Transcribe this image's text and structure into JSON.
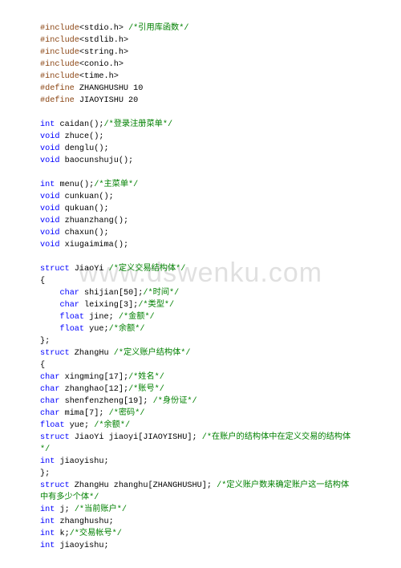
{
  "watermark": "www.dswenku.com",
  "lines": [
    [
      {
        "cls": "pre",
        "t": "#include"
      },
      {
        "cls": "id",
        "t": "<stdio.h> "
      },
      {
        "cls": "cm",
        "t": "/*引用库函数*/"
      }
    ],
    [
      {
        "cls": "pre",
        "t": "#include"
      },
      {
        "cls": "id",
        "t": "<stdlib.h>"
      }
    ],
    [
      {
        "cls": "pre",
        "t": "#include"
      },
      {
        "cls": "id",
        "t": "<string.h>"
      }
    ],
    [
      {
        "cls": "pre",
        "t": "#include"
      },
      {
        "cls": "id",
        "t": "<conio.h>"
      }
    ],
    [
      {
        "cls": "pre",
        "t": "#include"
      },
      {
        "cls": "id",
        "t": "<time.h>"
      }
    ],
    [
      {
        "cls": "pre",
        "t": "#define"
      },
      {
        "cls": "id",
        "t": " ZHANGHUSHU 10"
      }
    ],
    [
      {
        "cls": "pre",
        "t": "#define"
      },
      {
        "cls": "id",
        "t": " JIAOYISHU 20"
      }
    ],
    [],
    [
      {
        "cls": "kw",
        "t": "int"
      },
      {
        "cls": "id",
        "t": " caidan();"
      },
      {
        "cls": "cm",
        "t": "/*登录注册菜单*/"
      }
    ],
    [
      {
        "cls": "kw",
        "t": "void"
      },
      {
        "cls": "id",
        "t": " zhuce();"
      }
    ],
    [
      {
        "cls": "kw",
        "t": "void"
      },
      {
        "cls": "id",
        "t": " denglu();"
      }
    ],
    [
      {
        "cls": "kw",
        "t": "void"
      },
      {
        "cls": "id",
        "t": " baocunshuju();"
      }
    ],
    [],
    [
      {
        "cls": "kw",
        "t": "int"
      },
      {
        "cls": "id",
        "t": " menu();"
      },
      {
        "cls": "cm",
        "t": "/*主菜单*/"
      }
    ],
    [
      {
        "cls": "kw",
        "t": "void"
      },
      {
        "cls": "id",
        "t": " cunkuan();"
      }
    ],
    [
      {
        "cls": "kw",
        "t": "void"
      },
      {
        "cls": "id",
        "t": " qukuan();"
      }
    ],
    [
      {
        "cls": "kw",
        "t": "void"
      },
      {
        "cls": "id",
        "t": " zhuanzhang();"
      }
    ],
    [
      {
        "cls": "kw",
        "t": "void"
      },
      {
        "cls": "id",
        "t": " chaxun();"
      }
    ],
    [
      {
        "cls": "kw",
        "t": "void"
      },
      {
        "cls": "id",
        "t": " xiugaimima();"
      }
    ],
    [],
    [
      {
        "cls": "kw",
        "t": "struct"
      },
      {
        "cls": "id",
        "t": " JiaoYi "
      },
      {
        "cls": "cm",
        "t": "/*定义交易结构体*/"
      }
    ],
    [
      {
        "cls": "id",
        "t": "{"
      }
    ],
    [
      {
        "cls": "id",
        "t": "    "
      },
      {
        "cls": "kw",
        "t": "char"
      },
      {
        "cls": "id",
        "t": " shijian[50];"
      },
      {
        "cls": "cm",
        "t": "/*时间*/"
      }
    ],
    [
      {
        "cls": "id",
        "t": "    "
      },
      {
        "cls": "kw",
        "t": "char"
      },
      {
        "cls": "id",
        "t": " leixing[3];"
      },
      {
        "cls": "cm",
        "t": "/*类型*/"
      }
    ],
    [
      {
        "cls": "id",
        "t": "    "
      },
      {
        "cls": "kw",
        "t": "float"
      },
      {
        "cls": "id",
        "t": " jine; "
      },
      {
        "cls": "cm",
        "t": "/*金额*/"
      }
    ],
    [
      {
        "cls": "id",
        "t": "    "
      },
      {
        "cls": "kw",
        "t": "float"
      },
      {
        "cls": "id",
        "t": " yue;"
      },
      {
        "cls": "cm",
        "t": "/*余额*/"
      }
    ],
    [
      {
        "cls": "id",
        "t": "};"
      }
    ],
    [
      {
        "cls": "kw",
        "t": "struct"
      },
      {
        "cls": "id",
        "t": " ZhangHu "
      },
      {
        "cls": "cm",
        "t": "/*定义账户结构体*/"
      }
    ],
    [
      {
        "cls": "id",
        "t": "{"
      }
    ],
    [
      {
        "cls": "kw",
        "t": "char"
      },
      {
        "cls": "id",
        "t": " xingming[17];"
      },
      {
        "cls": "cm",
        "t": "/*姓名*/"
      }
    ],
    [
      {
        "cls": "kw",
        "t": "char"
      },
      {
        "cls": "id",
        "t": " zhanghao[12];"
      },
      {
        "cls": "cm",
        "t": "/*账号*/"
      }
    ],
    [
      {
        "cls": "kw",
        "t": "char"
      },
      {
        "cls": "id",
        "t": " shenfenzheng[19]; "
      },
      {
        "cls": "cm",
        "t": "/*身份证*/"
      }
    ],
    [
      {
        "cls": "kw",
        "t": "char"
      },
      {
        "cls": "id",
        "t": " mima[7]; "
      },
      {
        "cls": "cm",
        "t": "/*密码*/"
      }
    ],
    [
      {
        "cls": "kw",
        "t": "float"
      },
      {
        "cls": "id",
        "t": " yue; "
      },
      {
        "cls": "cm",
        "t": "/*余额*/"
      }
    ],
    [
      {
        "cls": "kw",
        "t": "struct"
      },
      {
        "cls": "id",
        "t": " JiaoYi jiaoyi[JIAOYISHU]; "
      },
      {
        "cls": "cm",
        "t": "/*在账户的结构体中在定义交易的结构体"
      }
    ],
    [
      {
        "cls": "cm",
        "t": "*/"
      }
    ],
    [
      {
        "cls": "kw",
        "t": "int"
      },
      {
        "cls": "id",
        "t": " jiaoyishu;"
      }
    ],
    [
      {
        "cls": "id",
        "t": "};"
      }
    ],
    [
      {
        "cls": "kw",
        "t": "struct"
      },
      {
        "cls": "id",
        "t": " ZhangHu zhanghu[ZHANGHUSHU]; "
      },
      {
        "cls": "cm",
        "t": "/*定义账户数来确定账户这一结构体"
      }
    ],
    [
      {
        "cls": "cm",
        "t": "中有多少个体*/"
      }
    ],
    [
      {
        "cls": "kw",
        "t": "int"
      },
      {
        "cls": "id",
        "t": " j; "
      },
      {
        "cls": "cm",
        "t": "/*当前账户*/"
      }
    ],
    [
      {
        "cls": "kw",
        "t": "int"
      },
      {
        "cls": "id",
        "t": " zhanghushu;"
      }
    ],
    [
      {
        "cls": "kw",
        "t": "int"
      },
      {
        "cls": "id",
        "t": " k;"
      },
      {
        "cls": "cm",
        "t": "/*交易帐号*/"
      }
    ],
    [
      {
        "cls": "kw",
        "t": "int"
      },
      {
        "cls": "id",
        "t": " jiaoyishu;"
      }
    ]
  ]
}
